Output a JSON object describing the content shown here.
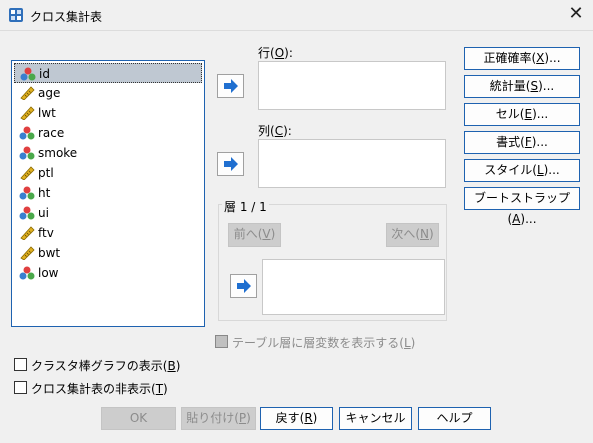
{
  "window": {
    "title": "クロス集計表",
    "close_glyph": "✕"
  },
  "variables": [
    {
      "name": "id",
      "type": "nominal",
      "selected": true
    },
    {
      "name": "age",
      "type": "scale"
    },
    {
      "name": "lwt",
      "type": "scale"
    },
    {
      "name": "race",
      "type": "nominal"
    },
    {
      "name": "smoke",
      "type": "nominal"
    },
    {
      "name": "ptl",
      "type": "scale"
    },
    {
      "name": "ht",
      "type": "nominal"
    },
    {
      "name": "ui",
      "type": "nominal"
    },
    {
      "name": "ftv",
      "type": "scale"
    },
    {
      "name": "bwt",
      "type": "scale"
    },
    {
      "name": "low",
      "type": "nominal"
    }
  ],
  "rows": {
    "label": "行(",
    "key": "O",
    "suffix": "):"
  },
  "columns": {
    "label": "列(",
    "key": "C",
    "suffix": "):"
  },
  "layer": {
    "title": "層 1 / 1",
    "prev_label": "前へ(",
    "prev_key": "V",
    "prev_suffix": ")",
    "next_label": "次へ(",
    "next_key": "N",
    "next_suffix": ")"
  },
  "side_buttons": [
    {
      "label": "正確確率(",
      "key": "X",
      "suffix": ")..."
    },
    {
      "label": "統計量(",
      "key": "S",
      "suffix": ")..."
    },
    {
      "label": "セル(",
      "key": "E",
      "suffix": ")..."
    },
    {
      "label": "書式(",
      "key": "F",
      "suffix": ")..."
    },
    {
      "label": "スタイル(",
      "key": "L",
      "suffix": ")..."
    },
    {
      "label": "ブートストラップ(",
      "key": "A",
      "suffix": ")..."
    }
  ],
  "layer_variables_check": {
    "label": "テーブル層に層変数を表示する(",
    "key": "L",
    "suffix": ")",
    "enabled": false
  },
  "clustered_bar_check": {
    "label": "クラスタ棒グラフの表示(",
    "key": "B",
    "suffix": ")",
    "checked": false
  },
  "suppress_tables_check": {
    "label": "クロス集計表の非表示(",
    "key": "T",
    "suffix": ")",
    "checked": false
  },
  "bottom_buttons": {
    "ok": {
      "label": "OK"
    },
    "paste": {
      "label": "貼り付け(",
      "key": "P",
      "suffix": ")"
    },
    "reset": {
      "label": "戻す(",
      "key": "R",
      "suffix": ")"
    },
    "cancel": {
      "label": "キャンセル"
    },
    "help": {
      "label": "ヘルプ"
    }
  },
  "colors": {
    "accent_border": "#1e62b0",
    "arrow": "#1f6fd0",
    "selection": "#bfc8d2",
    "disabled_bg": "#cdcdcd",
    "disabled_text": "#8c8c8c"
  }
}
